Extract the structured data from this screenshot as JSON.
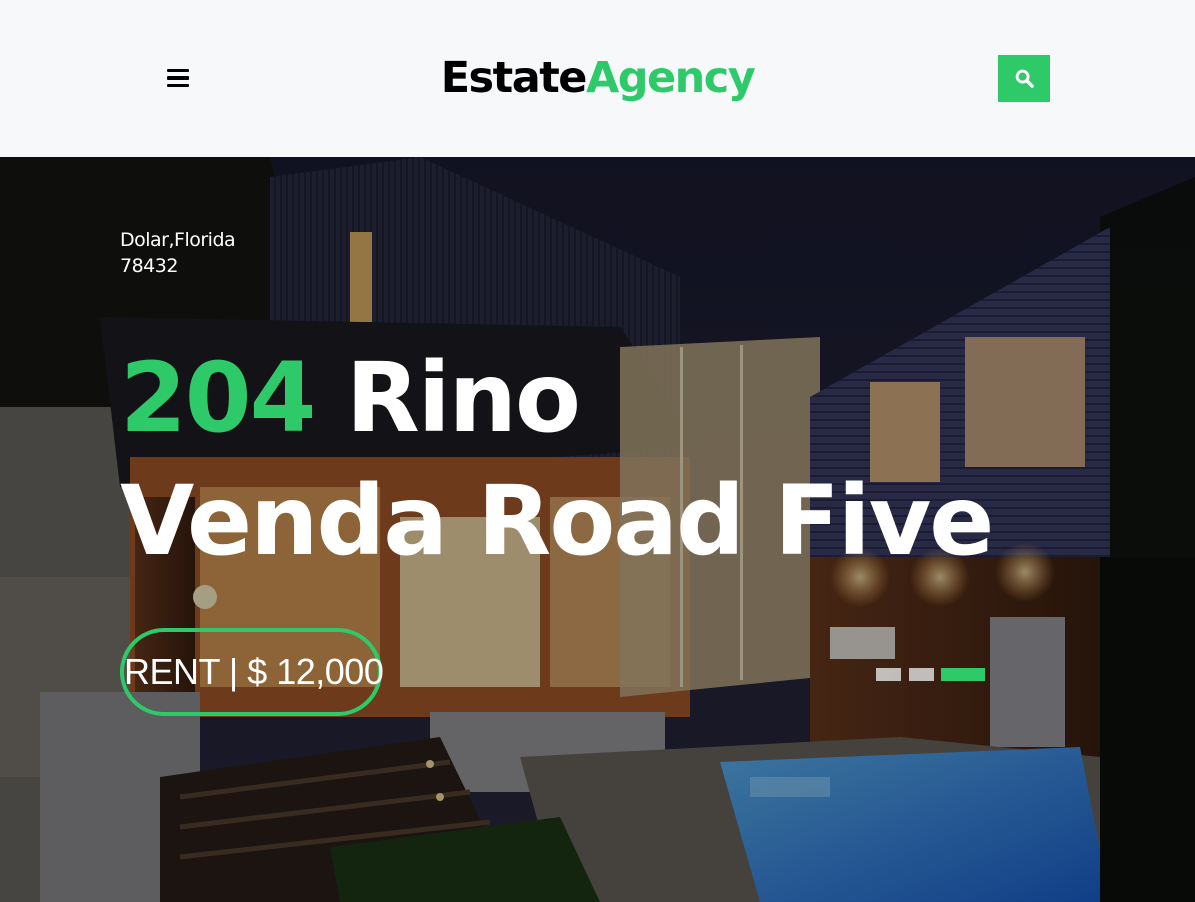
{
  "brand": {
    "part1": "Estate",
    "part2": "Agency"
  },
  "header": {
    "menu_icon": "hamburger-menu-icon",
    "search_icon": "search-icon"
  },
  "hero": {
    "location_line1": "Dolar,Florida",
    "location_line2": "78432",
    "title_number": "204",
    "title_rest_line1": " Rino",
    "title_line2": "Venda Road Five",
    "price_button": "RENT | $ 12,000",
    "background_image": "modern-house-night-pool-image"
  },
  "carousel": {
    "slide_count": 3,
    "active_index": 2
  },
  "colors": {
    "accent": "#2eca6a",
    "text_dark": "#000000",
    "navbar_bg": "#f7f8fa",
    "dot_inactive": "#d9d9d9"
  }
}
